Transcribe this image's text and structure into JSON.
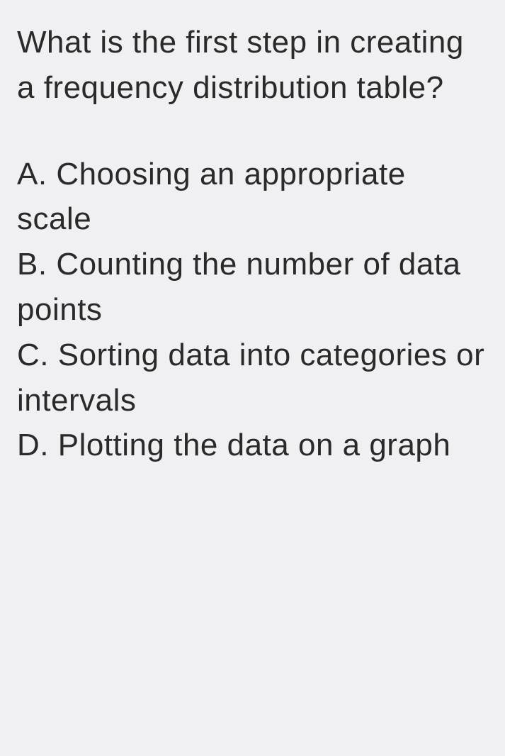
{
  "question": {
    "text": "What is the first step in creating a frequency distribution table?",
    "options": [
      {
        "label": "A.",
        "text": "Choosing an appropriate scale"
      },
      {
        "label": "B.",
        "text": "Counting the number of data points"
      },
      {
        "label": "C.",
        "text": "Sorting data into categories or intervals"
      },
      {
        "label": "D.",
        "text": "Plotting the data on a graph"
      }
    ]
  }
}
